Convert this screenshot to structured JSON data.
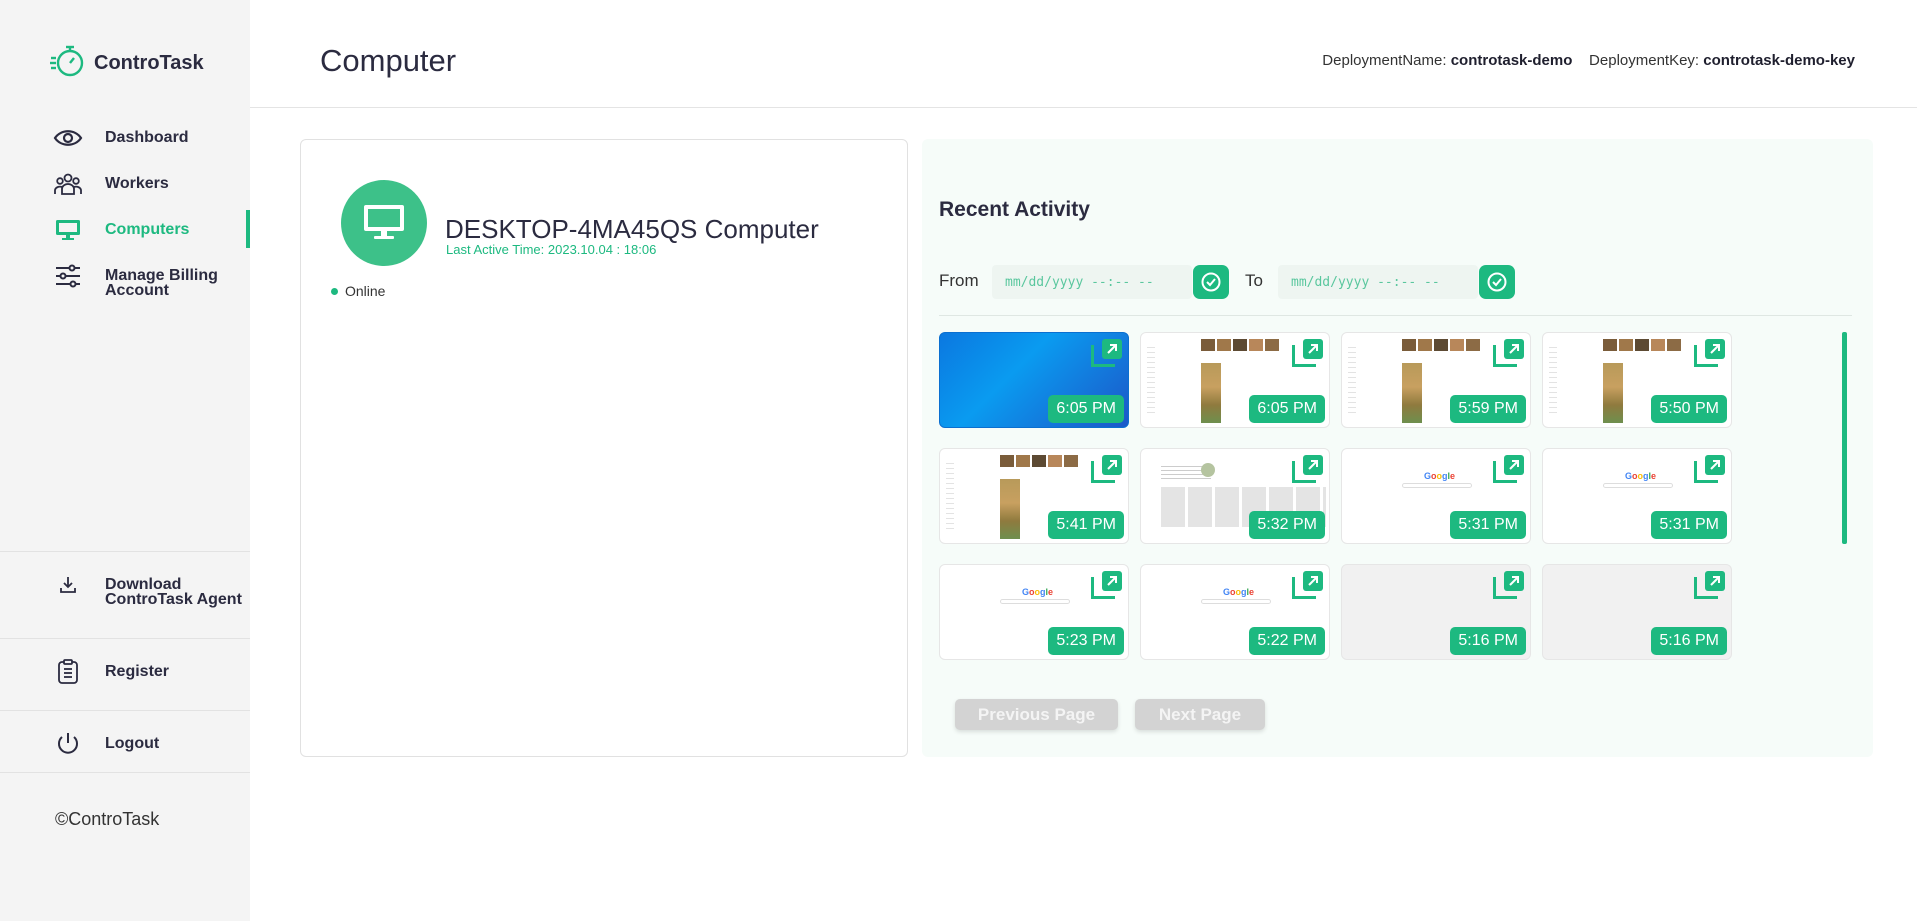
{
  "app": {
    "name": "ControTask"
  },
  "sidebar": {
    "items": [
      {
        "label": "Dashboard",
        "icon": "eye-icon"
      },
      {
        "label": "Workers",
        "icon": "users-icon"
      },
      {
        "label": "Computers",
        "icon": "monitor-icon",
        "active": true
      },
      {
        "label": "Manage Billing\nAccount",
        "icon": "sliders-icon"
      }
    ],
    "bottom_items": [
      {
        "label": "Download\nControTask Agent",
        "icon": "download-icon"
      },
      {
        "label": "Register",
        "icon": "clipboard-icon"
      },
      {
        "label": "Logout",
        "icon": "power-icon"
      }
    ],
    "copyright": "©ControTask"
  },
  "header": {
    "title": "Computer",
    "deployment_name_label": "DeploymentName:",
    "deployment_name": "controtask-demo",
    "deployment_key_label": "DeploymentKey:",
    "deployment_key": "controtask-demo-key"
  },
  "computer": {
    "name": "DESKTOP-4MA45QS Computer",
    "last_active": "Last Active Time: 2023.10.04 : 18:06",
    "status": "Online"
  },
  "activity": {
    "title": "Recent Activity",
    "from_label": "From",
    "to_label": "To",
    "from_placeholder": "mm/dd/yyyy --:-- --",
    "to_placeholder": "mm/dd/yyyy --:-- --",
    "thumbnails": [
      {
        "time": "6:05 PM",
        "kind": "desktop"
      },
      {
        "time": "6:05 PM",
        "kind": "images"
      },
      {
        "time": "5:59 PM",
        "kind": "images"
      },
      {
        "time": "5:50 PM",
        "kind": "images"
      },
      {
        "time": "5:41 PM",
        "kind": "images"
      },
      {
        "time": "5:32 PM",
        "kind": "page"
      },
      {
        "time": "5:31 PM",
        "kind": "google"
      },
      {
        "time": "5:31 PM",
        "kind": "google"
      },
      {
        "time": "5:23 PM",
        "kind": "google"
      },
      {
        "time": "5:22 PM",
        "kind": "google"
      },
      {
        "time": "5:16 PM",
        "kind": "blank"
      },
      {
        "time": "5:16 PM",
        "kind": "blank"
      }
    ],
    "prev_label": "Previous Page",
    "next_label": "Next Page"
  },
  "colors": {
    "accent": "#1db980",
    "sidebar_bg": "#f4f4f4",
    "panel_bg": "#f6fcf9"
  }
}
